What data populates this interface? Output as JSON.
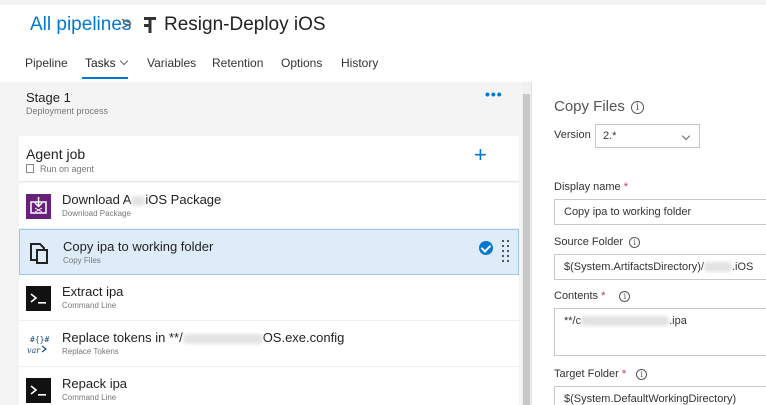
{
  "header": {
    "breadcrumb": "All pipelines",
    "separator": ">",
    "title": "Resign-Deploy iOS"
  },
  "tabs": [
    {
      "label": "Pipeline"
    },
    {
      "label": "Tasks"
    },
    {
      "label": "Variables"
    },
    {
      "label": "Retention"
    },
    {
      "label": "Options"
    },
    {
      "label": "History"
    }
  ],
  "stage": {
    "title": "Stage 1",
    "subtitle": "Deployment process",
    "menu": "•••"
  },
  "agent": {
    "title": "Agent job",
    "subtitle": "Run on agent",
    "add": "+"
  },
  "tasks": [
    {
      "title_a": "Download A",
      "title_b": "iOS Package",
      "subtitle": "Download Package"
    },
    {
      "title": "Copy ipa to working folder",
      "subtitle": "Copy Files"
    },
    {
      "title": "Extract ipa",
      "subtitle": "Command Line"
    },
    {
      "title_a": "Replace tokens in **/",
      "title_b": "OS.exe.config",
      "subtitle": "Replace Tokens"
    },
    {
      "title": "Repack ipa",
      "subtitle": "Command Line"
    }
  ],
  "panel": {
    "title": "Copy Files",
    "version_label": "Version",
    "version_value": "2.*",
    "display_name_label": "Display name",
    "display_name_value": "Copy ipa to working folder",
    "source_folder_label": "Source Folder",
    "source_folder_prefix": "$(System.ArtifactsDirectory)/",
    "source_folder_suffix": ".iOS",
    "contents_label": "Contents",
    "contents_prefix": "**/c",
    "contents_suffix": ".ipa",
    "target_folder_label": "Target Folder",
    "target_folder_value": "$(System.DefaultWorkingDirectory)",
    "required_mark": "*",
    "info_glyph": "i"
  },
  "colors": {
    "accent": "#0078d4",
    "selected_bg": "#deecf9",
    "required": "#c4314b",
    "download_icon": "#68217a"
  }
}
